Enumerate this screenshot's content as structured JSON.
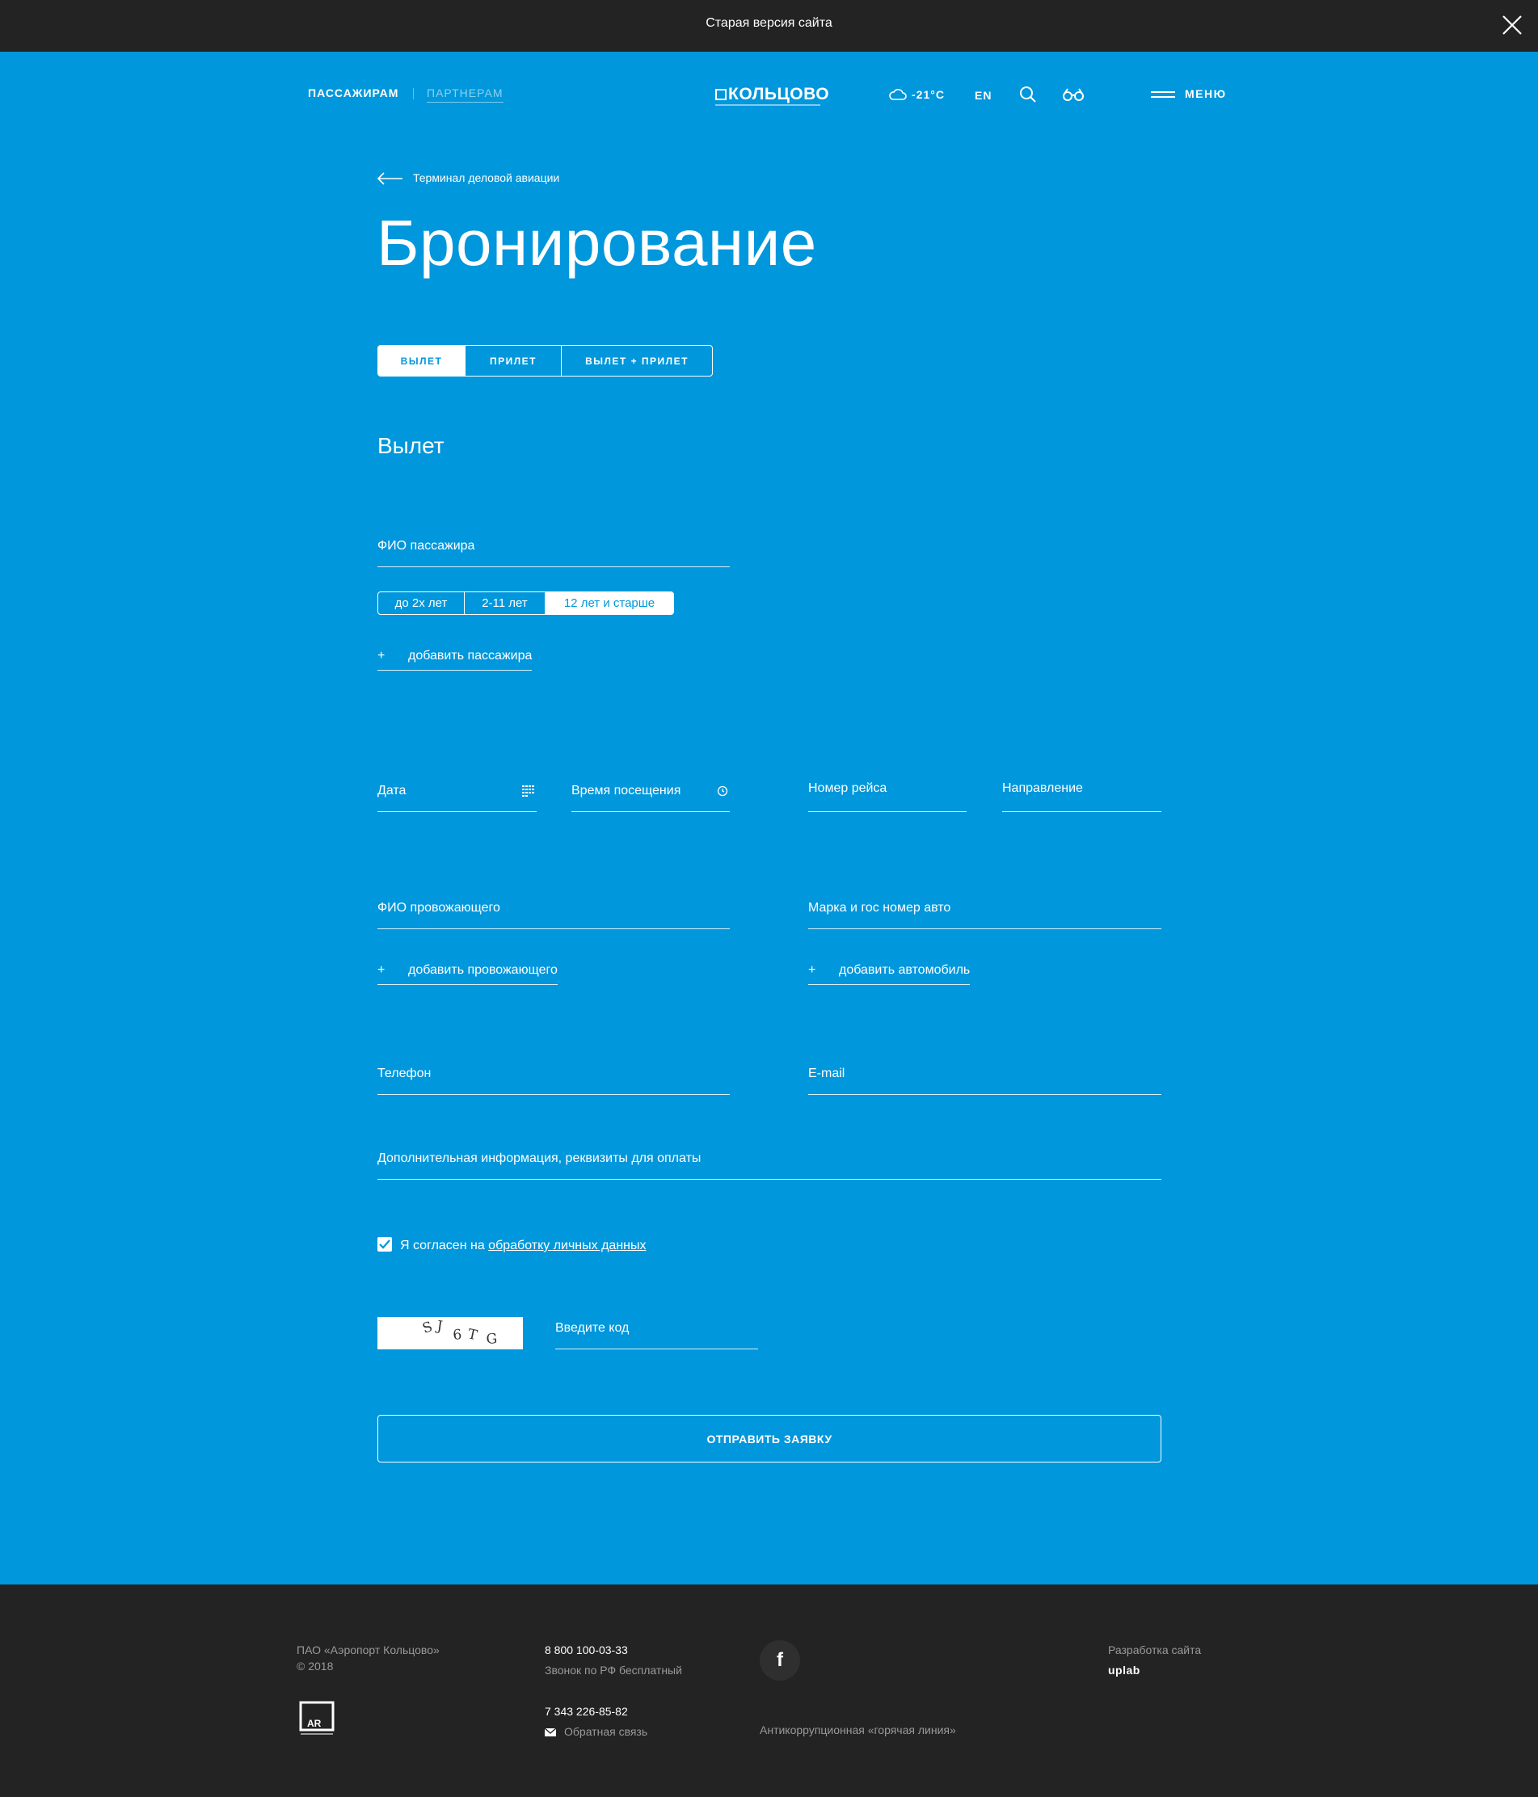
{
  "topbar": {
    "label": "Старая версия сайта"
  },
  "header": {
    "passengers": "ПАССАЖИРАМ",
    "partners": "ПАРТНЕРАМ",
    "logo": "КОЛЬЦОВО",
    "temperature": "-21°C",
    "lang": "EN",
    "menu": "МЕНЮ"
  },
  "breadcrumb": {
    "back_label": "Терминал деловой авиации"
  },
  "page": {
    "title": "Бронирование"
  },
  "tabs": [
    {
      "label": "Вылет",
      "active": true
    },
    {
      "label": "Прилет",
      "active": false
    },
    {
      "label": "Вылет + Прилет",
      "active": false
    }
  ],
  "section": {
    "title": "Вылет"
  },
  "form": {
    "passenger_name": "ФИО пассажира",
    "age_options": [
      "до 2х лет",
      "2-11 лет",
      "12 лет и старше"
    ],
    "age_selected": "12 лет и старше",
    "add_passenger": "добавить пассажира",
    "date": "Дата",
    "visit_time": "Время посещения",
    "flight_number": "Номер рейса",
    "direction": "Направление",
    "escort_name": "ФИО провожающего",
    "car": "Марка и гос номер авто",
    "add_escort": "добавить провожающего",
    "add_car": "добавить автомобиль",
    "phone": "Телефон",
    "email": "E-mail",
    "extra_info": "Дополнительная информация, реквизиты для оплаты",
    "consent_prefix": "Я согласен на",
    "consent_link": "обработку личных данных",
    "consent_checked": true,
    "captcha_code": "SJ6TG",
    "captcha_placeholder": "Введите код",
    "submit": "ОТПРАВИТЬ ЗАЯВКУ"
  },
  "footer": {
    "company": "ПАО «Аэропорт Кольцово»",
    "year": "© 2018",
    "phone1": "8 800 100-03-33",
    "phone1_note": "Звонок по РФ бесплатный",
    "phone2": "7 343 226-85-82",
    "feedback": "Обратная связь",
    "facebook": "f",
    "hotline": "Антикоррупционная «горячая линия»",
    "dev_label": "Разработка сайта",
    "dev_name": "uplab",
    "ar_logo": "AR"
  },
  "colors": {
    "primary": "#0097dc",
    "dark": "#232323"
  }
}
